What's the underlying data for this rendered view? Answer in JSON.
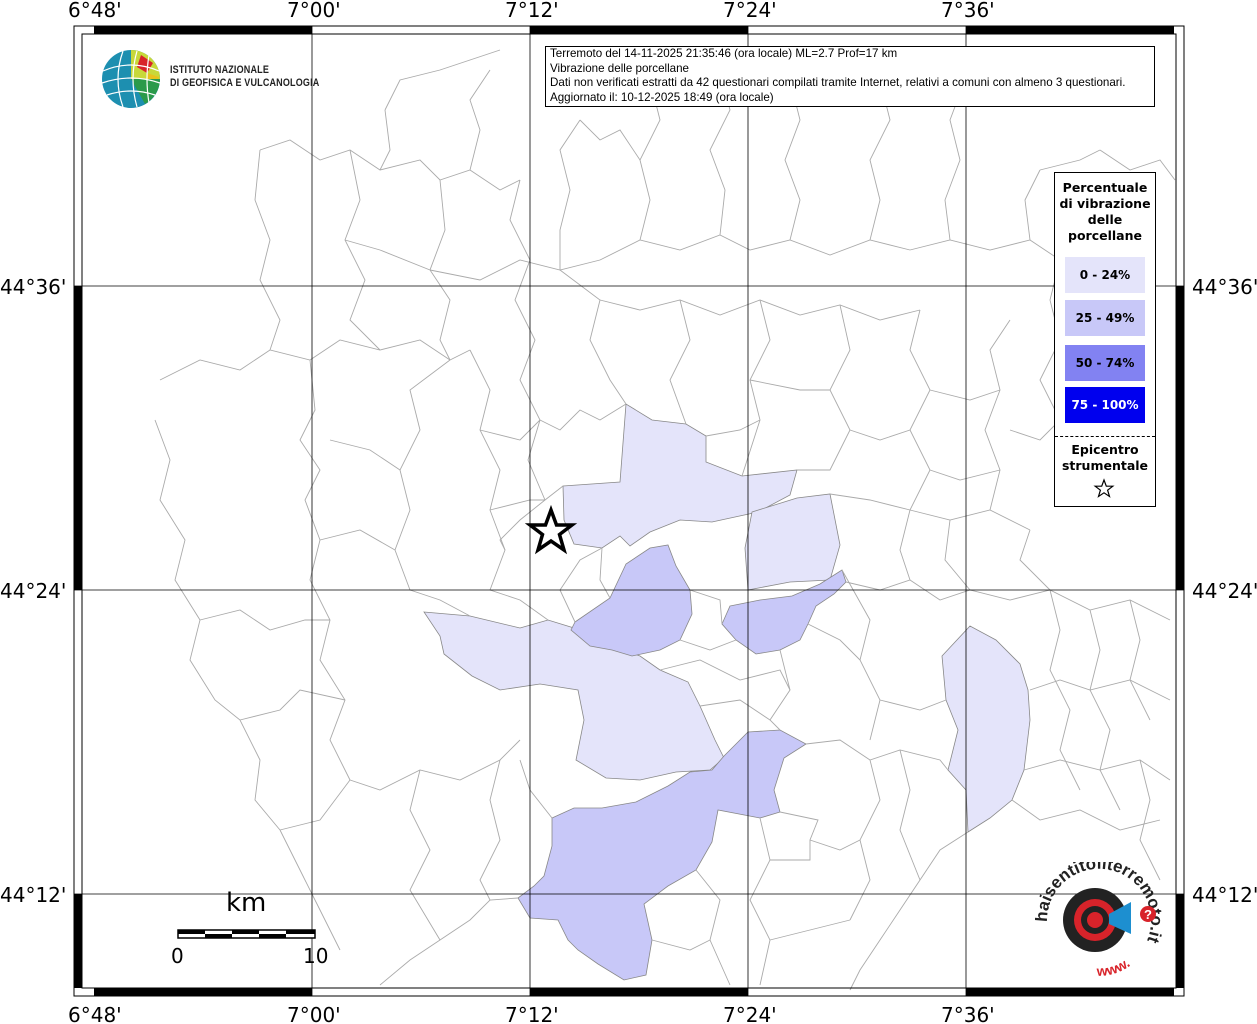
{
  "info_box": {
    "line1": "Terremoto del 14-11-2025 21:35:46 (ora locale) ML=2.7 Prof=17 km",
    "line2": "Vibrazione delle porcellane",
    "line3": "Dati non verificati estratti da 42 questionari compilati tramite Internet, relativi a comuni con almeno 3 questionari.",
    "line4": "Aggiornato il: 10-12-2025 18:49 (ora locale)"
  },
  "logo": {
    "line1": "ISTITUTO NAZIONALE",
    "line2": "DI GEOFISICA E VULCANOLOGIA"
  },
  "axes": {
    "lon_ticks": [
      "6°48'",
      "7°00'",
      "7°12'",
      "7°24'",
      "7°36'"
    ],
    "lat_ticks": [
      "44°36'",
      "44°24'",
      "44°12'"
    ]
  },
  "legend": {
    "title": "Percentuale di vibrazione delle porcellane",
    "classes": [
      {
        "label": "0 - 24%",
        "color": "#e4e4fa",
        "text_color": "#000000"
      },
      {
        "label": "25 - 49%",
        "color": "#c8c8f8",
        "text_color": "#000000"
      },
      {
        "label": "50 - 74%",
        "color": "#8282f2",
        "text_color": "#000000"
      },
      {
        "label": "75 - 100%",
        "color": "#0000ee",
        "text_color": "#ffffff"
      }
    ],
    "epicenter_label": "Epicentro strumentale"
  },
  "scale_bar": {
    "unit": "km",
    "start": "0",
    "end": "10"
  },
  "watermark": {
    "text": "haisentitoilterremoto.it",
    "url_text": "www."
  }
}
